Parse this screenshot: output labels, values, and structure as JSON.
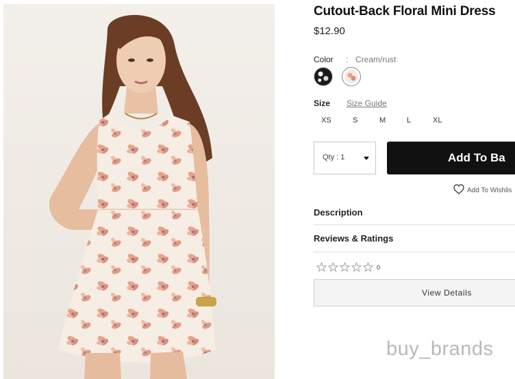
{
  "product": {
    "title": "Cutout-Back Floral Mini Dress",
    "price": "$12.90"
  },
  "color": {
    "label": "Color",
    "separator": ":",
    "selected": "Cream/rust",
    "swatches": [
      {
        "name": "black-floral",
        "color": "#1b1b1b"
      },
      {
        "name": "cream-rust",
        "color": "#f6ebe3",
        "selected": true
      }
    ]
  },
  "size": {
    "label": "Size",
    "guide_label": "Size Guide",
    "options": [
      "XS",
      "S",
      "M",
      "L",
      "XL"
    ]
  },
  "purchase": {
    "qty_label": "Qty : 1",
    "add_button_label": "Add To Ba",
    "wishlist_label": "Add To Wishlis"
  },
  "sections": {
    "description": "Description",
    "reviews": "Reviews & Ratings"
  },
  "rating": {
    "stars": 0,
    "max_stars": 5,
    "count": "0"
  },
  "view_details_label": "View Details",
  "watermark": "buy_brands",
  "icons": {
    "heart": "heart-outline-icon",
    "star": "star-outline-icon",
    "qty_caret": "caret-down-icon"
  },
  "colors": {
    "button_bg": "#111111",
    "photo_bg": "#f1ede8",
    "watermark": "#b9b9b9"
  }
}
